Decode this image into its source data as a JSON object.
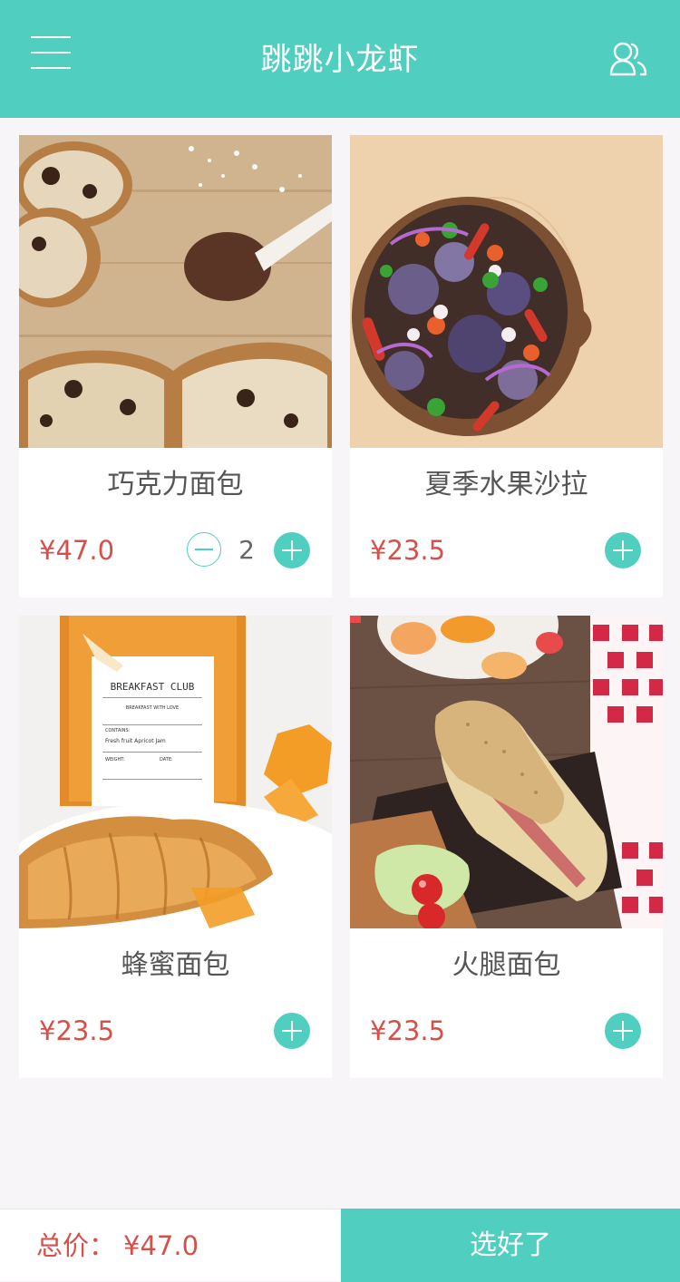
{
  "header": {
    "title": "跳跳小龙虾",
    "menu_icon": "menu-icon",
    "user_icon": "users-icon",
    "color": "#50cfc0"
  },
  "products": [
    {
      "name": "巧克力面包",
      "price": "¥47.0",
      "quantity": "2",
      "image": "chocolate-bread-photo"
    },
    {
      "name": "夏季水果沙拉",
      "price": "¥23.5",
      "image": "fruit-salad-photo"
    },
    {
      "name": "蜂蜜面包",
      "price": "¥23.5",
      "image": "honey-bread-photo"
    },
    {
      "name": "火腿面包",
      "price": "¥23.5",
      "image": "ham-bread-photo"
    }
  ],
  "footer": {
    "total_label": "总价：",
    "total_value": "¥47.0",
    "confirm_label": "选好了"
  },
  "colors": {
    "accent": "#50cfc0",
    "price": "#d6504a"
  }
}
